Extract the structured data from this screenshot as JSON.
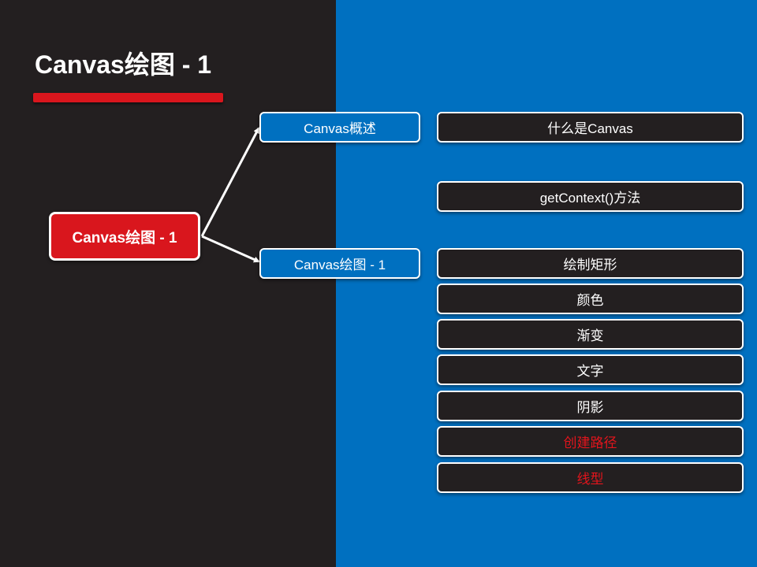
{
  "slide": {
    "title": "Canvas绘图 - 1",
    "colors": {
      "left_panel": "#231f20",
      "right_panel": "#0070c0",
      "accent_red": "#d9161d",
      "highlight_text": "#e3141c"
    }
  },
  "mindmap": {
    "root": "Canvas绘图 - 1",
    "branches": [
      {
        "label": "Canvas概述",
        "items": [
          {
            "label": "什么是Canvas",
            "highlight": false
          },
          {
            "label": "getContext()方法",
            "highlight": false
          }
        ]
      },
      {
        "label": "Canvas绘图 - 1",
        "items": [
          {
            "label": "绘制矩形",
            "highlight": false
          },
          {
            "label": "颜色",
            "highlight": false
          },
          {
            "label": "渐变",
            "highlight": false
          },
          {
            "label": "文字",
            "highlight": false
          },
          {
            "label": "阴影",
            "highlight": false
          },
          {
            "label": "创建路径",
            "highlight": true
          },
          {
            "label": "线型",
            "highlight": true
          }
        ]
      }
    ]
  }
}
